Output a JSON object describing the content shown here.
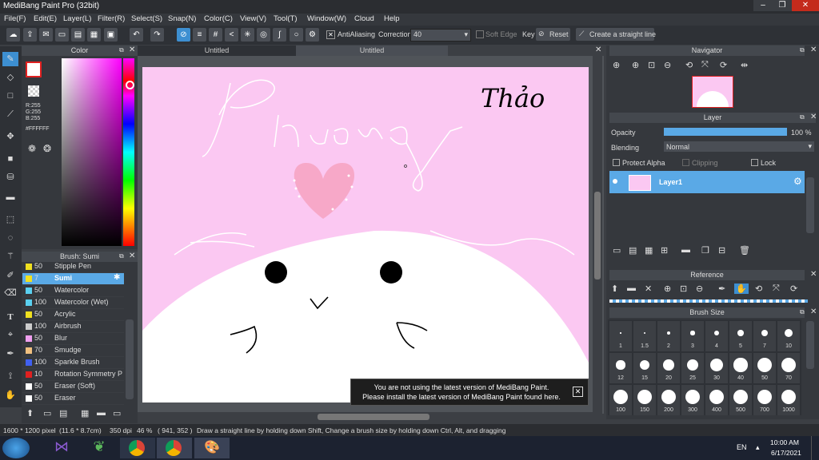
{
  "window": {
    "title": "MediBang Paint Pro (32bit)",
    "minimize": "–",
    "maximize": "❐",
    "close": "✕"
  },
  "menu": [
    "File(F)",
    "Edit(E)",
    "Layer(L)",
    "Filter(R)",
    "Select(S)",
    "Snap(N)",
    "Color(C)",
    "View(V)",
    "Tool(T)",
    "Window(W)",
    "Cloud",
    "Help"
  ],
  "toolbar": {
    "antialiasing_label": "AntiAliasing",
    "correction_label": "Correction",
    "correction_value": "40",
    "soft_edge_label": "Soft Edge",
    "key_label": "Key",
    "reset_label": "Reset",
    "straight_line_label": "Create a straight line"
  },
  "tabs": [
    "Untitled",
    "Untitled"
  ],
  "color_panel": {
    "title": "Color",
    "r": "R:255",
    "g": "G:255",
    "b": "B:255",
    "hex": "#FFFFFF"
  },
  "brush_panel": {
    "title": "Brush: Sumi",
    "items": [
      {
        "size": "50",
        "name": "Stipple Pen",
        "color": "#f0e020"
      },
      {
        "size": "7",
        "name": "Sumi",
        "color": "#f0e020"
      },
      {
        "size": "50",
        "name": "Watercolor",
        "color": "#5ad0f0"
      },
      {
        "size": "100",
        "name": "Watercolor (Wet)",
        "color": "#5ad0f0"
      },
      {
        "size": "50",
        "name": "Acrylic",
        "color": "#f0e020"
      },
      {
        "size": "100",
        "name": "Airbrush",
        "color": "#cccccc"
      },
      {
        "size": "50",
        "name": "Blur",
        "color": "#f0a0f0"
      },
      {
        "size": "70",
        "name": "Smudge",
        "color": "#f0c080"
      },
      {
        "size": "100",
        "name": "Sparkle Brush",
        "color": "#4060f0"
      },
      {
        "size": "10",
        "name": "Rotation Symmetry P",
        "color": "#e02020"
      },
      {
        "size": "50",
        "name": "Eraser (Soft)",
        "color": "#ffffff"
      },
      {
        "size": "50",
        "name": "Eraser",
        "color": "#ffffff"
      }
    ]
  },
  "canvas_text": {
    "signature": "Thảo",
    "script_word": "Phương"
  },
  "notice": {
    "line1": "You are not using the latest version of MediBang Paint.",
    "line2": "Please install the latest version of MediBang Paint found here."
  },
  "navigator": {
    "title": "Navigator"
  },
  "layer_panel": {
    "title": "Layer",
    "opacity_label": "Opacity",
    "opacity_value": "100 %",
    "opacity_fraction": 1.0,
    "blending_label": "Blending",
    "blending_value": "Normal",
    "protect_alpha": "Protect Alpha",
    "clipping": "Clipping",
    "lock": "Lock",
    "layer_name": "Layer1"
  },
  "reference": {
    "title": "Reference"
  },
  "brush_size": {
    "title": "Brush Size",
    "sizes": [
      "1",
      "1.5",
      "2",
      "3",
      "4",
      "5",
      "7",
      "10",
      "12",
      "15",
      "20",
      "25",
      "30",
      "40",
      "50",
      "70",
      "100",
      "150",
      "200",
      "300",
      "400",
      "500",
      "700",
      "1000"
    ]
  },
  "status": {
    "dims": "1600 * 1200 pixel",
    "cm": "(11.6 * 8.7cm)",
    "dpi": "350 dpi",
    "zoom": "46 %",
    "coords": "( 941, 352 )",
    "hint": "Draw a straight line by holding down Shift, Change a brush size by holding down Ctrl, Alt, and dragging"
  },
  "taskbar": {
    "lang": "EN",
    "time": "10:00 AM",
    "date": "6/17/2021"
  },
  "colors": {
    "canvas_bg": "#fbc8f2",
    "accent": "#3d8fd1",
    "heart": "#f7a8c8"
  }
}
